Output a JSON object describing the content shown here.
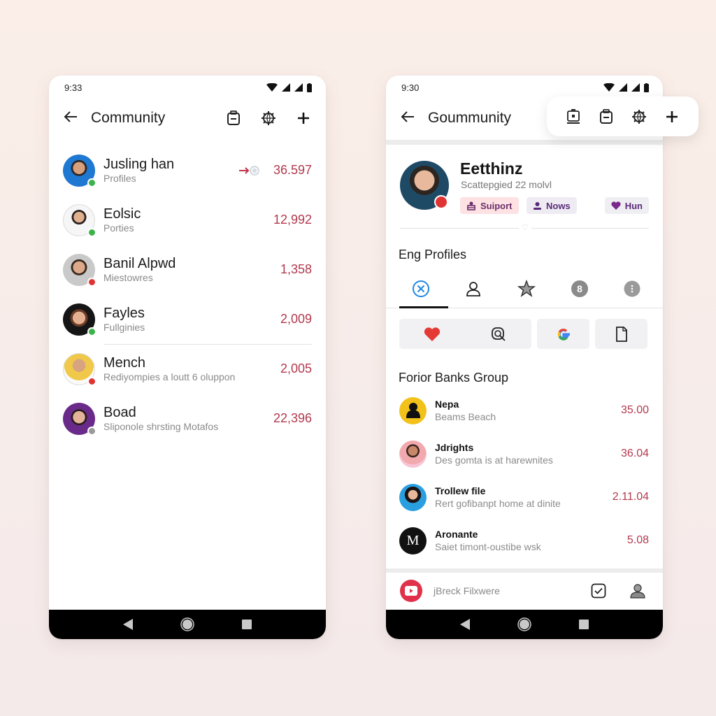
{
  "left_screen": {
    "status_time": "9:33",
    "title": "Community",
    "actions": [
      {
        "icon": "clipboard-minus-icon"
      },
      {
        "icon": "globe-gear-icon"
      },
      {
        "icon": "plus-icon"
      }
    ],
    "rows": [
      {
        "name": "Jusling han",
        "sub": "Profiles",
        "value": "36.597",
        "avatar_bg": "#1f78d1",
        "badge": "#3cb34a",
        "extra_icon": "transfer-icon"
      },
      {
        "name": "Eolsic",
        "sub": "Porties",
        "value": "12,992",
        "avatar_bg": "#f2f2f2",
        "badge": "#3cb34a"
      },
      {
        "name": "Banil Alpwd",
        "sub": "Miestowres",
        "value": "1,358",
        "avatar_bg": "#cfcfcf",
        "badge": "#e03434"
      },
      {
        "name": "Fayles",
        "sub": "Fullginies",
        "value": "2,009",
        "avatar_bg": "#1a1a1a",
        "badge": "#3cb34a"
      },
      {
        "name": "Mench",
        "sub": "Rediyompies a loutt 6 oluppon",
        "value": "2,005",
        "avatar_bg": "#f3d36a",
        "badge": "#e03434"
      },
      {
        "name": "Boad",
        "sub": "Sliponole shrsting Motafos",
        "value": "22,396",
        "avatar_bg": "#6a2a8a",
        "badge": "#9a9a9a"
      }
    ]
  },
  "right_screen": {
    "status_time": "9:30",
    "title": "Goummunity",
    "floating_actions": [
      {
        "icon": "tray-download-icon"
      },
      {
        "icon": "clipboard-minus-icon"
      },
      {
        "icon": "globe-gear-icon"
      },
      {
        "icon": "plus-icon"
      }
    ],
    "profile": {
      "name": "Eetthinz",
      "subtitle": "Scattepgied 22 molvl",
      "chips": [
        {
          "label": "Suiport",
          "icon": "support-icon"
        },
        {
          "label": "Nows",
          "icon": "person-icon"
        },
        {
          "label": "Hun",
          "icon": "heart-icon"
        }
      ]
    },
    "profiles_section_title": "Eng Profiles",
    "tabs": [
      {
        "icon": "close-circle-icon",
        "active": true
      },
      {
        "icon": "person-icon",
        "active": false
      },
      {
        "icon": "star-icon",
        "active": false
      },
      {
        "icon": "badge-8-icon",
        "active": false
      },
      {
        "icon": "more-icon",
        "active": false
      }
    ],
    "quick_actions": [
      {
        "icon": "heart-icon"
      },
      {
        "icon": "chat-search-icon"
      },
      {
        "icon": "google-icon"
      },
      {
        "icon": "document-icon"
      }
    ],
    "group_title": "Forior Banks Group",
    "group_rows": [
      {
        "name": "Nepa",
        "sub": "Beams Beach",
        "value": "35.00",
        "avatar_bg": "#f2c21b"
      },
      {
        "name": "Jdrights",
        "sub": "Des gomta is at harewnites",
        "value": "36.04",
        "avatar_bg": "#f2a9ad"
      },
      {
        "name": "Trollew file",
        "sub": "Rert gofibanpt home at dinite",
        "value": "2.11.04",
        "avatar_bg": "#2a9fe0"
      },
      {
        "name": "Aronante",
        "sub": "Saiet timont-oustibe wsk",
        "value": "5.08",
        "avatar_bg": "#111111",
        "letter": "M"
      }
    ],
    "bottom_bar": {
      "label": "jBreck Filxwere",
      "left_icon": "youtube-icon",
      "right_icons": [
        "checkbox-icon",
        "account-icon"
      ]
    }
  },
  "colors": {
    "accent_value": "#b23a4e",
    "active_tab": "#1e88e5",
    "youtube_red": "#e0304a"
  }
}
